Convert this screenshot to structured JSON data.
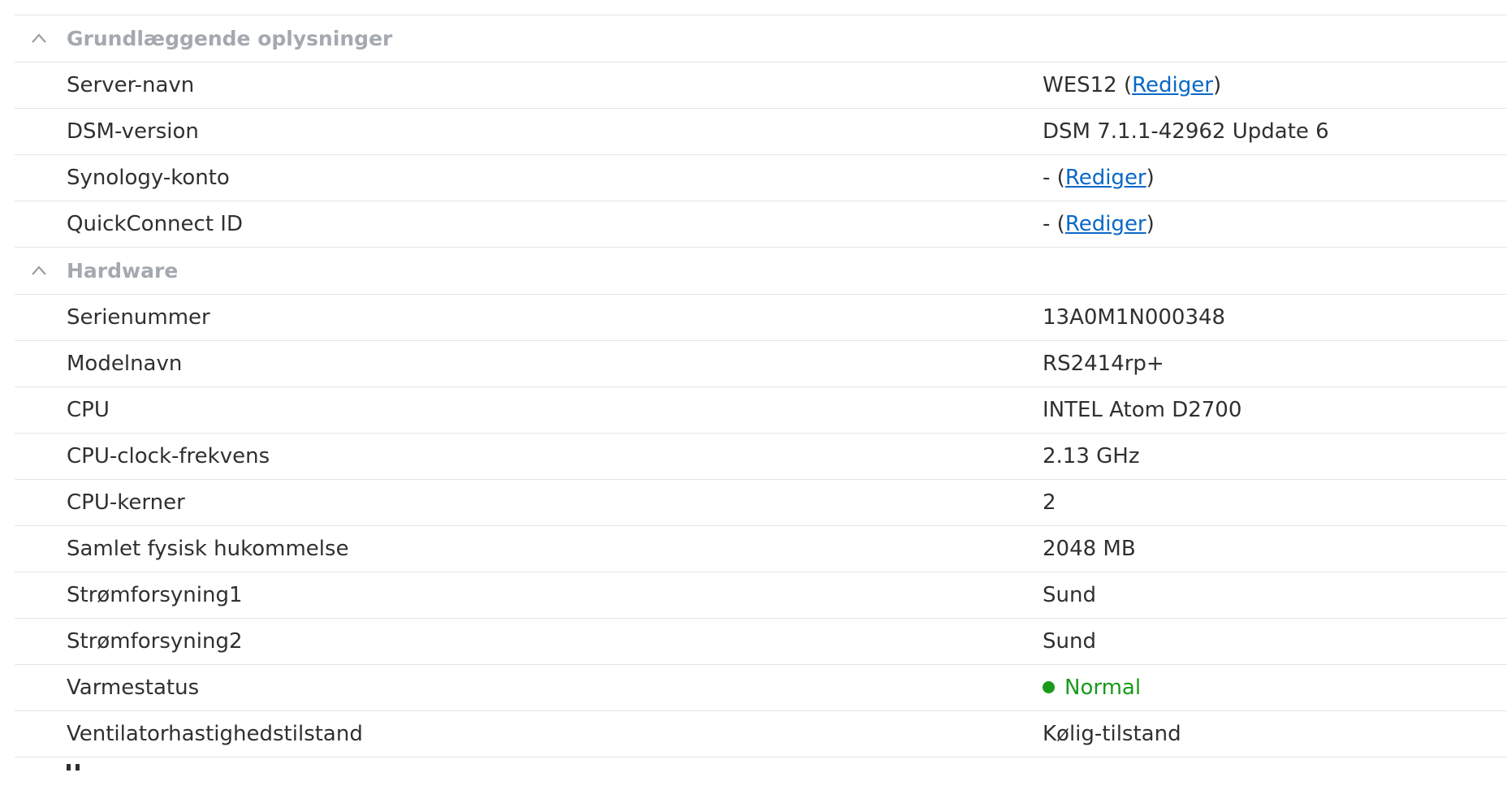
{
  "sections": {
    "basic": {
      "title": "Grundlæggende oplysninger",
      "server_name": {
        "label": "Server-navn",
        "value": "WES12",
        "edit_link": "Rediger"
      },
      "dsm_version": {
        "label": "DSM-version",
        "value": "DSM 7.1.1-42962 Update 6"
      },
      "synology_account": {
        "label": "Synology-konto",
        "value": "-",
        "edit_link": "Rediger"
      },
      "quickconnect": {
        "label": "QuickConnect ID",
        "value": "-",
        "edit_link": "Rediger"
      }
    },
    "hardware": {
      "title": "Hardware",
      "rows": [
        {
          "label": "Serienummer",
          "value": "13A0M1N000348"
        },
        {
          "label": "Modelnavn",
          "value": "RS2414rp+"
        },
        {
          "label": "CPU",
          "value": "INTEL Atom D2700"
        },
        {
          "label": "CPU-clock-frekvens",
          "value": "2.13 GHz"
        },
        {
          "label": "CPU-kerner",
          "value": "2"
        },
        {
          "label": "Samlet fysisk hukommelse",
          "value": "2048 MB"
        },
        {
          "label": "Strømforsyning1",
          "value": "Sund"
        },
        {
          "label": "Strømforsyning2",
          "value": "Sund"
        }
      ],
      "thermal": {
        "label": "Varmestatus",
        "value": "Normal",
        "status_color": "#1a9a1a"
      },
      "fan": {
        "label": "Ventilatorhastighedstilstand",
        "value": "Kølig-tilstand"
      }
    }
  },
  "colors": {
    "link": "#0a68c7",
    "group_title": "#a4a9b0",
    "divider": "#e3e6ea",
    "status_ok": "#1a9a1a"
  },
  "icons": {
    "collapse": "chevron-up-icon",
    "status": "status-dot-icon"
  }
}
